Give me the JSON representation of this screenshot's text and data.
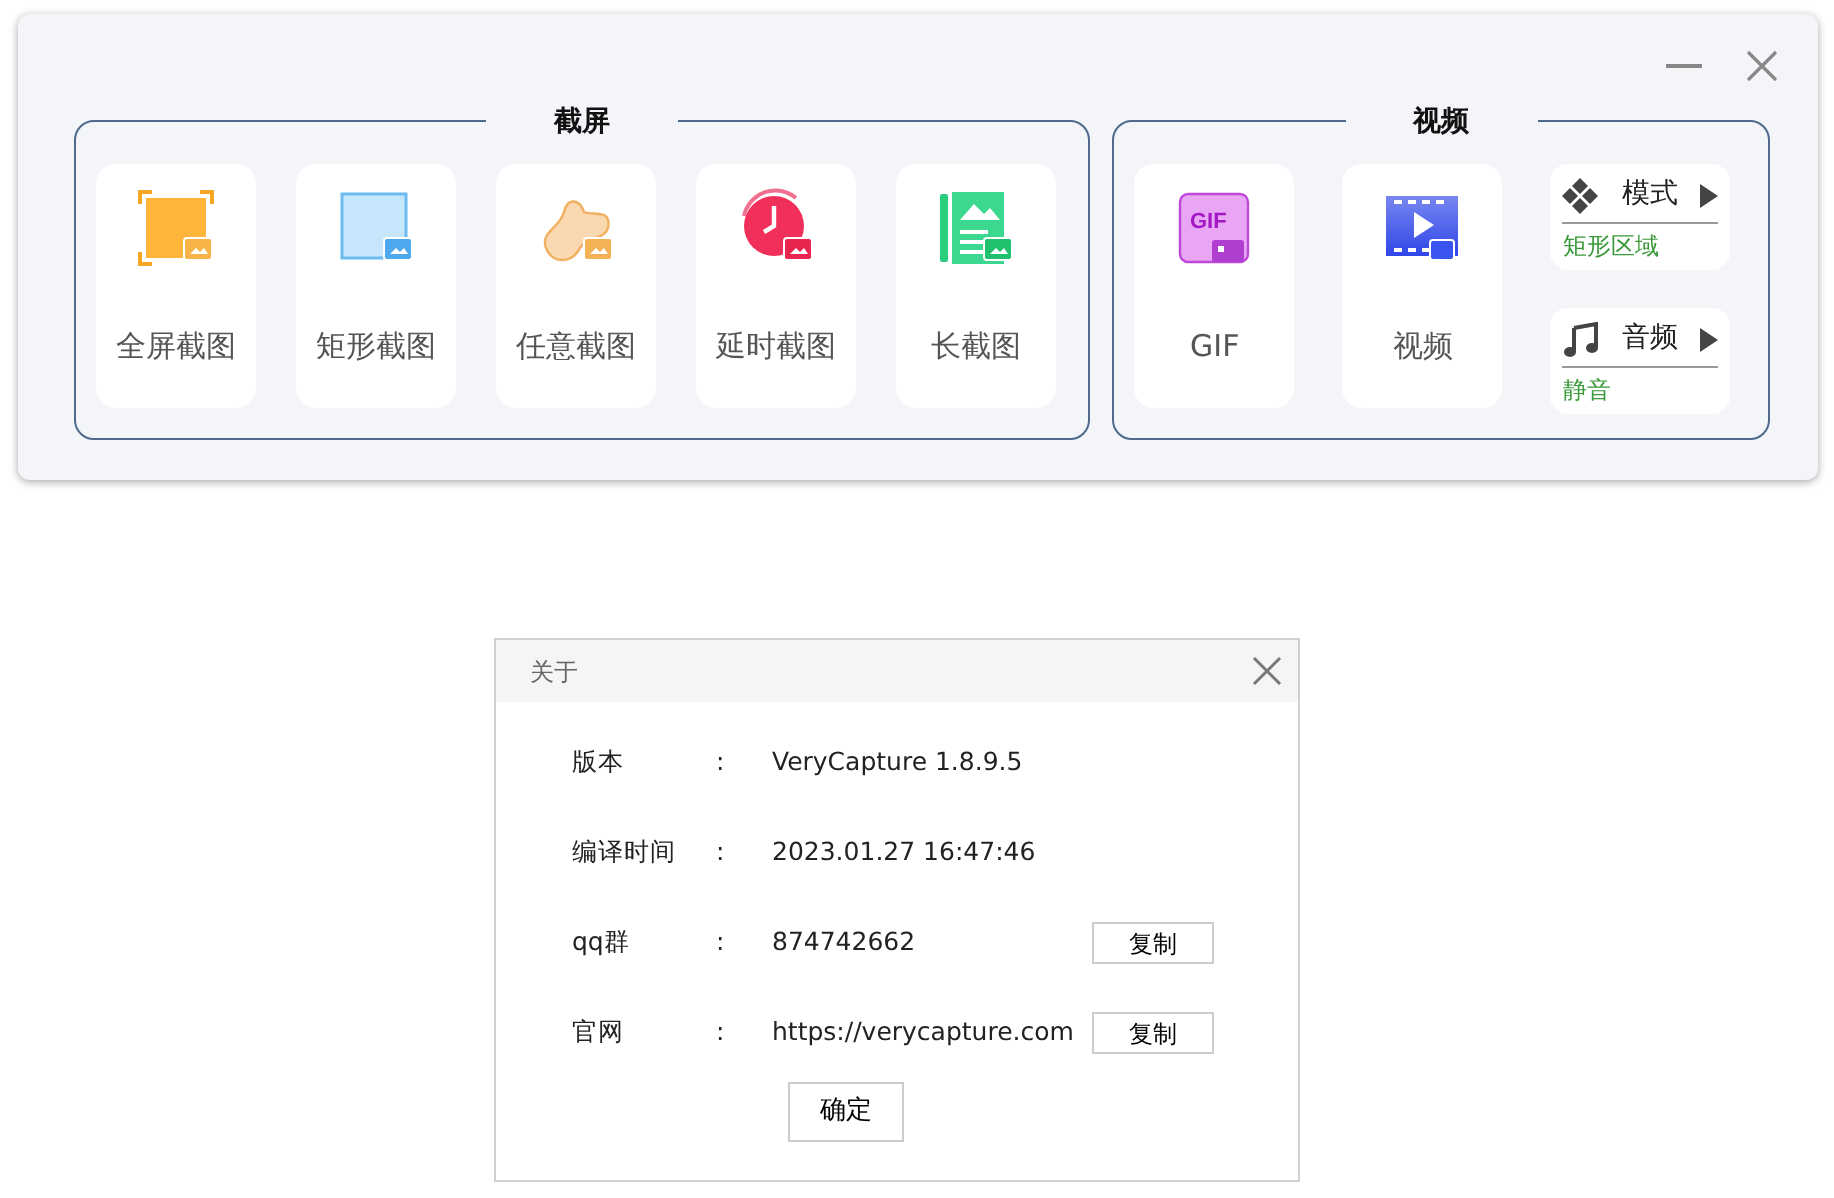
{
  "toolbar": {
    "groups": [
      {
        "title": "截屏",
        "tools": [
          {
            "label": "全屏截图"
          },
          {
            "label": "矩形截图"
          },
          {
            "label": "任意截图"
          },
          {
            "label": "延时截图"
          },
          {
            "label": "长截图"
          }
        ]
      },
      {
        "title": "视频",
        "tools": [
          {
            "label": "GIF",
            "icon_text": "GIF"
          },
          {
            "label": "视频"
          }
        ],
        "options": [
          {
            "label": "模式",
            "value": "矩形区域"
          },
          {
            "label": "音频",
            "value": "静音"
          }
        ]
      }
    ]
  },
  "about_dialog": {
    "title": "关于",
    "rows": [
      {
        "label": "版本",
        "separator": ":",
        "value": "VeryCapture 1.8.9.5"
      },
      {
        "label": "编译时间",
        "separator": ":",
        "value": "2023.01.27 16:47:46"
      },
      {
        "label": "qq群",
        "separator": ":",
        "value": "874742662",
        "button": "复制"
      },
      {
        "label": "官网",
        "separator": ":",
        "value": "https://verycapture.com",
        "button": "复制"
      }
    ],
    "ok_button": "确定"
  }
}
